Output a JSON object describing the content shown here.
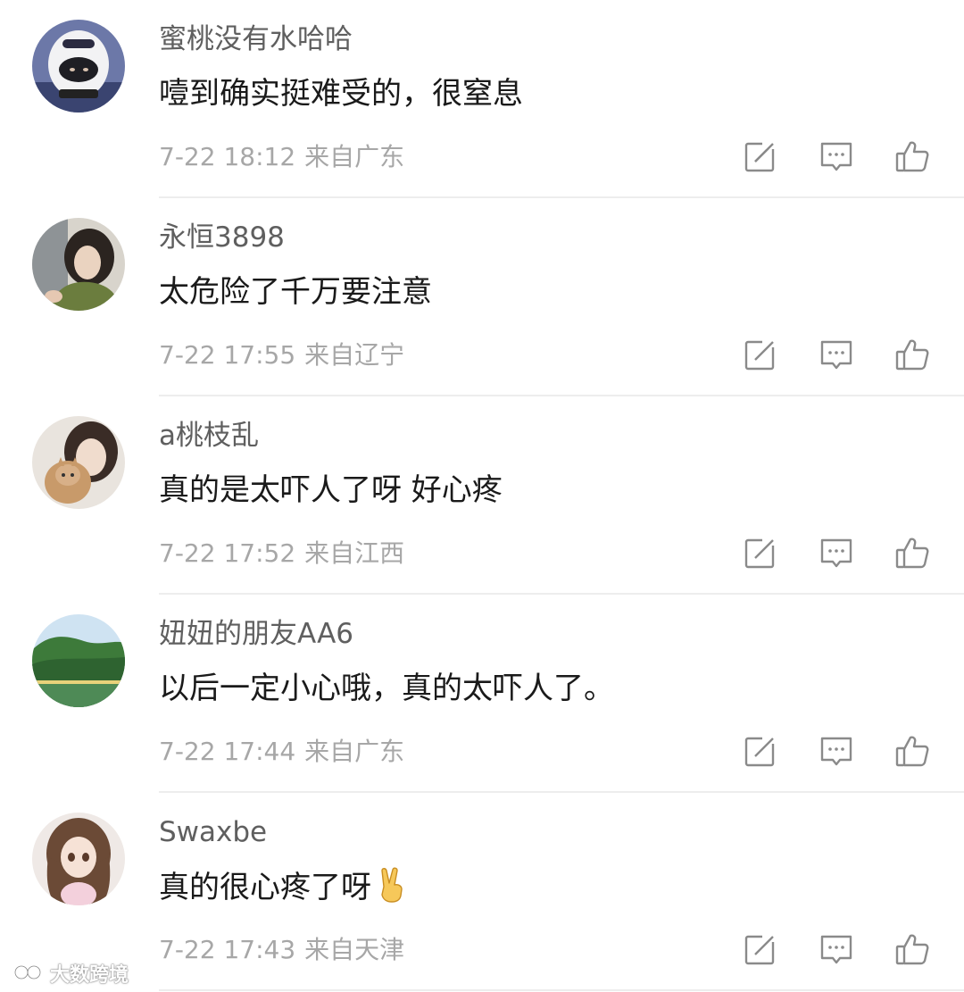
{
  "comments": [
    {
      "username": "蜜桃没有水哈哈",
      "text": "噎到确实挺难受的，很窒息",
      "time": "7-22 18:12",
      "location": "来自广东",
      "avatar_icon": "helmet-person-avatar"
    },
    {
      "username": "永恒3898",
      "text": "太危险了千万要注意",
      "time": "7-22 17:55",
      "location": "来自辽宁",
      "avatar_icon": "girl-portrait-avatar"
    },
    {
      "username": "a桃枝乱",
      "text": "真的是太吓人了呀 好心疼",
      "time": "7-22 17:52",
      "location": "来自江西",
      "avatar_icon": "girl-with-cat-avatar"
    },
    {
      "username": "妞妞的朋友AA6",
      "text": "以后一定小心哦，真的太吓人了。",
      "time": "7-22 17:44",
      "location": "来自广东",
      "avatar_icon": "landscape-avatar"
    },
    {
      "username": "Swaxbe",
      "text": "真的很心疼了呀",
      "emoji": "✌",
      "time": "7-22 17:43",
      "location": "来自天津",
      "avatar_icon": "anime-girl-avatar"
    }
  ],
  "actions": {
    "share_icon": "share-edit-icon",
    "reply_icon": "comment-bubble-icon",
    "like_icon": "thumbs-up-icon"
  },
  "watermark": {
    "text": "大数跨境",
    "icon": "watermark-logo-icon"
  },
  "colors": {
    "username": "#5f5f5f",
    "text": "#1a1a1a",
    "meta": "#a7a7a7",
    "divider": "#ededed",
    "icon": "#8a8a8a"
  }
}
